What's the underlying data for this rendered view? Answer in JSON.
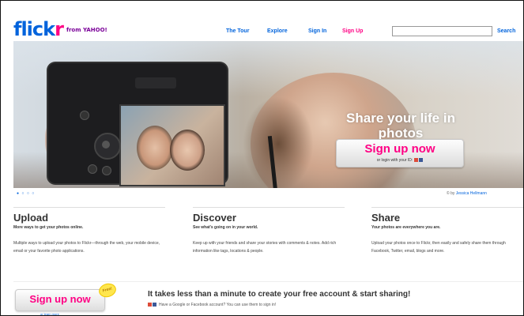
{
  "header": {
    "logo": {
      "text_blue": "flick",
      "text_pink": "r",
      "yahoo": "from YAHOO!"
    },
    "nav": {
      "tour": "The Tour",
      "explore": "Explore",
      "sign_in": "Sign In",
      "sign_up": "Sign Up"
    },
    "search": {
      "placeholder": "",
      "button": "Search"
    }
  },
  "hero": {
    "tagline": "Share your life in photos",
    "signup_button": "Sign up now",
    "signup_sub": "or login with your ID:",
    "credit_prefix": "© by",
    "credit_name": "Jessica Hellmann",
    "pager": "● ○ ○ ○"
  },
  "columns": [
    {
      "title": "Upload",
      "subtitle": "More ways to get your photos online.",
      "body": "Multiple ways to upload your photos to Flickr—through the web, your mobile device, email or your favorite photo applications."
    },
    {
      "title": "Discover",
      "subtitle": "See what's going on in your world.",
      "body": "Keep up with your friends and share your stories with comments & notes. Add rich information like tags, locations & people."
    },
    {
      "title": "Share",
      "subtitle": "Your photos are everywhere you are.",
      "body": "Upload your photos once to Flickr, then easily and safely share them through Facebook, Twitter, email, blogs and more."
    }
  ],
  "cta": {
    "button": "Sign up now",
    "badge": "Free!",
    "sublink": "or learn more",
    "title": "It takes less than a minute to create your free account & start sharing!",
    "subtitle": "Have a Google or Facebook account? You can use them to sign in!"
  },
  "colors": {
    "brand_blue": "#0063dc",
    "brand_pink": "#ff0084"
  }
}
